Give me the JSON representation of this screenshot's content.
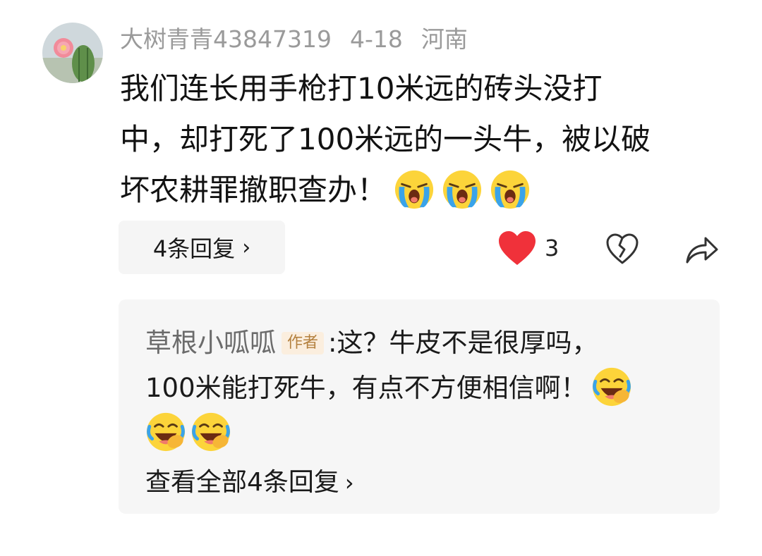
{
  "comment": {
    "username": "大树青青43847319",
    "date": "4-18",
    "location": "河南",
    "text_lines": [
      "我们连长用手枪打10米远的砖头没打",
      "中，却打死了100米远的一头牛，被以破",
      "坏农耕罪撤职查办！"
    ],
    "trailing_emojis": [
      "crying-face-icon",
      "crying-face-icon",
      "crying-face-icon"
    ],
    "replies_button_label": "4条回复",
    "like_count": "3",
    "liked": true,
    "colors": {
      "like": "#f0313a",
      "meta": "#9a9a9a"
    }
  },
  "reply": {
    "username": "草根小呱呱",
    "author_badge": "作者",
    "separator": ":",
    "text_line1": "这？牛皮不是很厚吗，",
    "text_line2": "100米能打死牛，有点不方便相信啊！",
    "emojis": [
      "laugh-cry-face-icon",
      "laugh-cry-face-icon",
      "laugh-cry-face-icon"
    ],
    "view_all_label": "查看全部4条回复",
    "colors": {
      "badge_bg": "#fbeede",
      "badge_text": "#b4813f"
    }
  }
}
